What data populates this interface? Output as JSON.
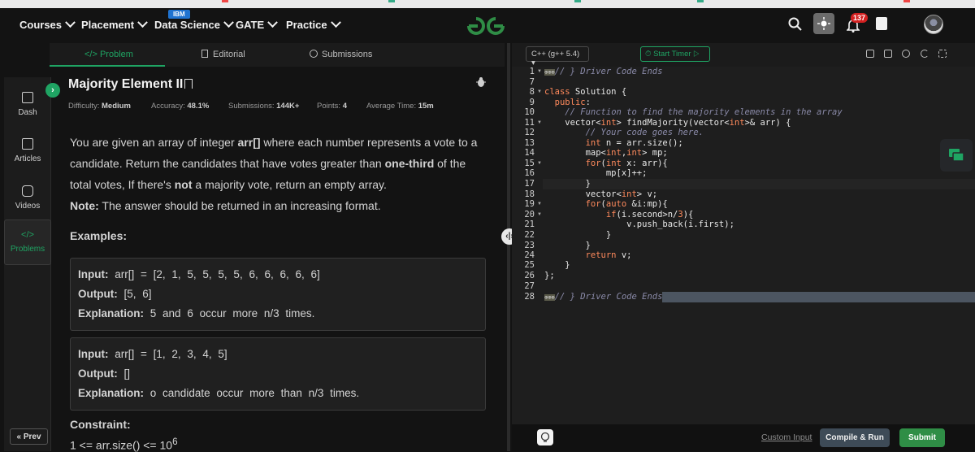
{
  "nav": {
    "courses": "Courses",
    "placement": "Placement",
    "data_science": "Data Science",
    "data_science_badge": "IBM",
    "gate": "GATE",
    "practice": "Practice",
    "notification_count": "137"
  },
  "sidebar": {
    "dash": "Dash",
    "articles": "Articles",
    "videos": "Videos",
    "problems": "Problems",
    "prev": "« Prev"
  },
  "tabs": {
    "problem": "</> Problem",
    "editorial": "Editorial",
    "submissions": "Submissions"
  },
  "problem": {
    "title": "Majority Element II",
    "difficulty_label": "Difficulty:",
    "difficulty": "Medium",
    "accuracy_label": "Accuracy:",
    "accuracy": "48.1%",
    "submissions_label": "Submissions:",
    "submissions": "144K+",
    "points_label": "Points:",
    "points": "4",
    "avg_time_label": "Average Time:",
    "avg_time": "15m",
    "desc_1": "You are given an array of integer ",
    "desc_arr": "arr[]",
    "desc_2": " where each number represents a vote to a candidate. Return the candidates that have votes greater than ",
    "desc_third": "one-third",
    "desc_3": " of the total votes, If there's ",
    "desc_not": "not",
    "desc_4": " a majority vote, return an empty array.",
    "note_label": "Note:",
    "note": " The answer should be returned in an increasing format.",
    "examples_label": "Examples:",
    "ex1_input_label": "Input:",
    "ex1_input": "arr[] = [2, 1, 5, 5, 5, 5, 6, 6, 6, 6, 6]",
    "ex1_output_label": "Output:",
    "ex1_output": "[5, 6]",
    "ex1_expl_label": "Explanation:",
    "ex1_expl": "5 and 6 occur more n/3 times.",
    "ex2_input_label": "Input:",
    "ex2_input": "arr[] = [1, 2, 3, 4, 5]",
    "ex2_output_label": "Output:",
    "ex2_output": "[]",
    "ex2_expl_label": "Explanation:",
    "ex2_expl": "o candidate occur more than n/3 times.",
    "constraint_label": "Constraint:",
    "constraint_text": "1 <= arr.size() <= 10",
    "constraint_exp": "6"
  },
  "editor": {
    "language": "C++ (g++ 5.4)",
    "start_timer": "Start Timer",
    "line_numbers": [
      "1",
      "7",
      "8",
      "9",
      "10",
      "11",
      "12",
      "13",
      "14",
      "15",
      "16",
      "17",
      "18",
      "19",
      "20",
      "21",
      "22",
      "23",
      "24",
      "25",
      "26",
      "27",
      "28"
    ],
    "custom_input": "Custom Input",
    "compile_run": "Compile & Run",
    "submit": "Submit"
  }
}
